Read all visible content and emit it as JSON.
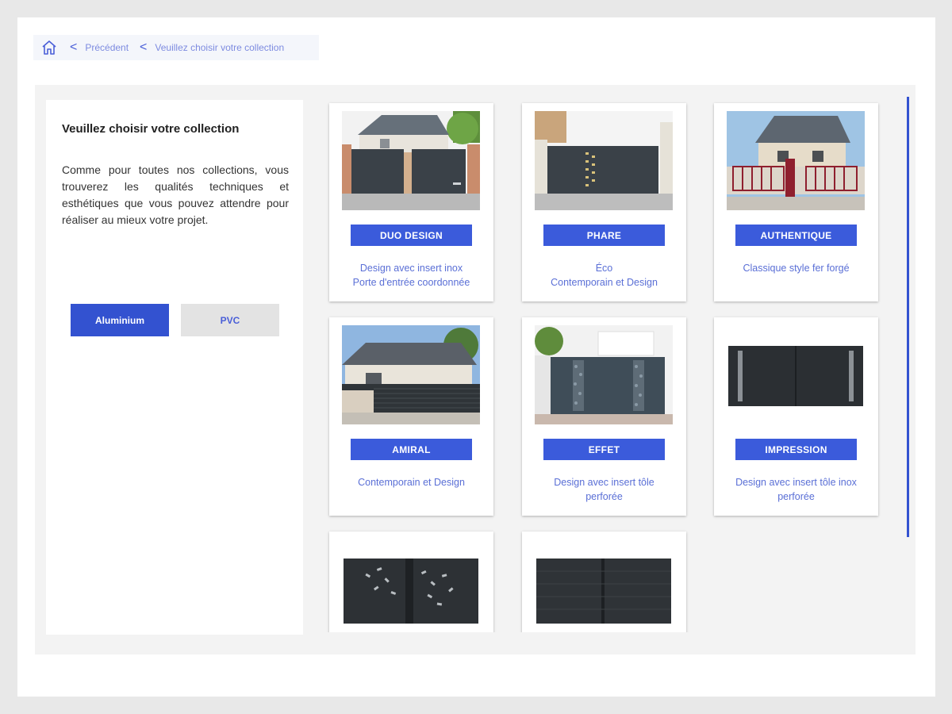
{
  "breadcrumb": {
    "home_icon": "home-icon",
    "previous": "Précédent",
    "current": "Veuillez choisir votre collection"
  },
  "left_panel": {
    "title": "Veuillez choisir votre collection",
    "description": "Comme pour toutes nos collections, vous trouverez les qualités techniques et esthétiques que vous pouvez attendre pour réaliser au mieux votre projet.",
    "materials": [
      {
        "label": "Aluminium",
        "active": true
      },
      {
        "label": "PVC",
        "active": false
      }
    ]
  },
  "collections": [
    {
      "name": "DUO DESIGN",
      "desc_1": "Design avec insert inox",
      "desc_2": "Porte d'entrée coordonnée"
    },
    {
      "name": "PHARE",
      "desc_1": "Éco",
      "desc_2": "Contemporain et Design"
    },
    {
      "name": "AUTHENTIQUE",
      "desc_1": "Classique style fer forgé",
      "desc_2": ""
    },
    {
      "name": "AMIRAL",
      "desc_1": "Contemporain et Design",
      "desc_2": ""
    },
    {
      "name": "EFFET",
      "desc_1": "Design avec insert tôle",
      "desc_2": "perforée"
    },
    {
      "name": "IMPRESSION",
      "desc_1": "Design avec insert tôle inox",
      "desc_2": "perforée"
    },
    {
      "name": "",
      "desc_1": "",
      "desc_2": ""
    },
    {
      "name": "",
      "desc_1": "",
      "desc_2": ""
    }
  ],
  "colors": {
    "accent": "#3352d0",
    "card_button": "#3b5bdb",
    "link_text": "#5a6fd6",
    "gate_gray": "#3a4148"
  }
}
